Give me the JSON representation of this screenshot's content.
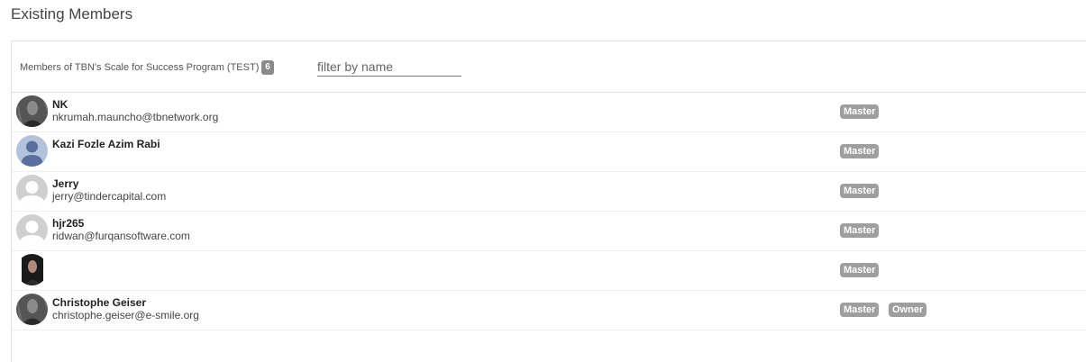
{
  "page": {
    "title": "Existing Members"
  },
  "panel": {
    "members_label": "Members of TBN's Scale for Success Program (TEST)",
    "member_count": "6",
    "filter_placeholder": "filter by name",
    "filter_value": ""
  },
  "members": [
    {
      "name": "NK",
      "email": "nkrumah.mauncho@tbnetwork.org",
      "avatar": "photo-icon",
      "roles": [
        "Master"
      ]
    },
    {
      "name": "Kazi Fozle Azim Rabi",
      "email": "",
      "avatar": "default-user-icon",
      "roles": [
        "Master"
      ]
    },
    {
      "name": "Jerry",
      "email": "jerry@tindercapital.com",
      "avatar": "placeholder-user-icon",
      "roles": [
        "Master"
      ]
    },
    {
      "name": "hjr265",
      "email": "ridwan@furqansoftware.com",
      "avatar": "placeholder-user-icon",
      "roles": [
        "Master"
      ]
    },
    {
      "name": "",
      "email": "",
      "avatar": "photo-icon",
      "roles": [
        "Master"
      ]
    },
    {
      "name": "Christophe Geiser",
      "email": "christophe.geiser@e-smile.org",
      "avatar": "photo-icon",
      "roles": [
        "Master",
        "Owner"
      ]
    }
  ],
  "colors": {
    "badge_bg": "#9e9e9e",
    "count_badge_bg": "#8a8a8a",
    "default_avatar_bg": "#b4c3dc",
    "default_avatar_fg": "#5a6f9e",
    "placeholder_avatar_bg": "#cfcfcf"
  }
}
